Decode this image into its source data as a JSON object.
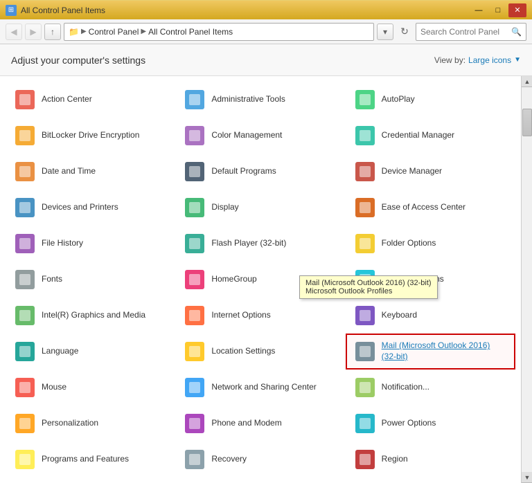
{
  "titlebar": {
    "title": "All Control Panel Items",
    "icon": "⊞",
    "min_btn": "—",
    "max_btn": "□",
    "close_btn": "✕"
  },
  "addressbar": {
    "back_btn": "◀",
    "forward_btn": "▶",
    "up_btn": "↑",
    "path": [
      "Control Panel",
      "All Control Panel Items"
    ],
    "refresh_btn": "↻",
    "search_placeholder": "Search Control Panel",
    "search_icon": "🔍"
  },
  "header": {
    "title": "Adjust your computer's settings",
    "view_by_label": "View by:",
    "view_by_value": "Large icons",
    "dropdown_arrow": "▼"
  },
  "items": [
    {
      "label": "Action Center",
      "col": 0
    },
    {
      "label": "Administrative Tools",
      "col": 1
    },
    {
      "label": "AutoPlay",
      "col": 2
    },
    {
      "label": "BitLocker Drive Encryption",
      "col": 0
    },
    {
      "label": "Color Management",
      "col": 1
    },
    {
      "label": "Credential Manager",
      "col": 2
    },
    {
      "label": "Date and Time",
      "col": 0
    },
    {
      "label": "Default Programs",
      "col": 1
    },
    {
      "label": "Device Manager",
      "col": 2
    },
    {
      "label": "Devices and Printers",
      "col": 0
    },
    {
      "label": "Display",
      "col": 1
    },
    {
      "label": "Ease of Access Center",
      "col": 2
    },
    {
      "label": "File History",
      "col": 0
    },
    {
      "label": "Flash Player (32-bit)",
      "col": 1
    },
    {
      "label": "Folder Options",
      "col": 2
    },
    {
      "label": "Fonts",
      "col": 0
    },
    {
      "label": "HomeGroup",
      "col": 1
    },
    {
      "label": "Indexing Options",
      "col": 2
    },
    {
      "label": "Intel(R) Graphics and Media",
      "col": 0
    },
    {
      "label": "Internet Options",
      "col": 1
    },
    {
      "label": "Keyboard",
      "col": 2
    },
    {
      "label": "Language",
      "col": 0
    },
    {
      "label": "Location Settings",
      "col": 1
    },
    {
      "label": "Mail (Microsoft Outlook 2016) (32-bit)",
      "col": 2,
      "highlighted": true
    },
    {
      "label": "Mouse",
      "col": 0
    },
    {
      "label": "Network and Sharing Center",
      "col": 1
    },
    {
      "label": "Notification...",
      "col": 2
    },
    {
      "label": "Personalization",
      "col": 0
    },
    {
      "label": "Phone and Modem",
      "col": 1
    },
    {
      "label": "Power Options",
      "col": 2
    },
    {
      "label": "Programs and Features",
      "col": 0
    },
    {
      "label": "Recovery",
      "col": 1
    },
    {
      "label": "Region",
      "col": 2
    }
  ],
  "tooltip": {
    "line1": "Mail (Microsoft Outlook 2016) (32-bit)",
    "line2": "Microsoft Outlook Profiles"
  }
}
